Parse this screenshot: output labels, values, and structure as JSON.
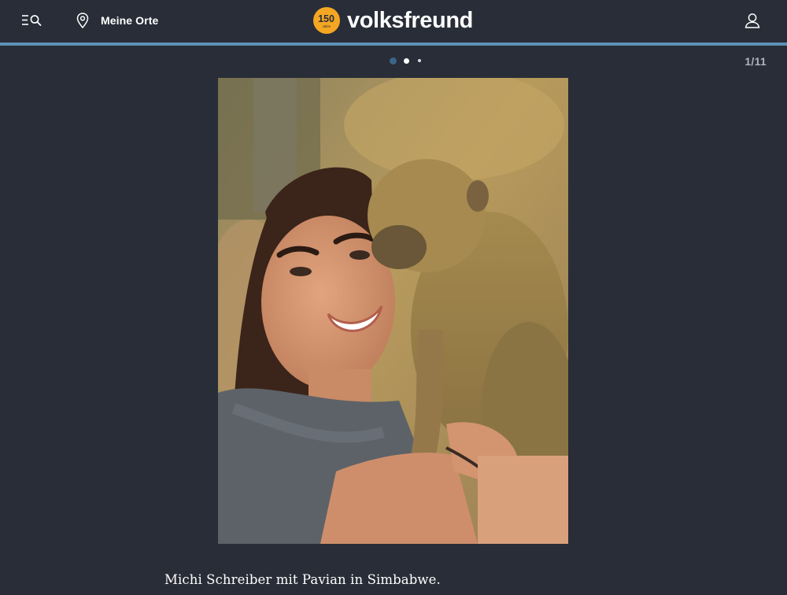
{
  "header": {
    "menu_search": {
      "icon": "menu-search-icon"
    },
    "places": {
      "icon": "location-pin-icon",
      "label": "Meine Orte"
    },
    "logo": {
      "badge_number": "150",
      "badge_sub": "Jahre",
      "brand": "volksfreund",
      "badge_color": "#f5a623"
    },
    "account": {
      "icon": "user-icon"
    },
    "accent_rule_color": "#5d91b3"
  },
  "gallery": {
    "counter": "1/11",
    "pagination_dots": [
      "active",
      "next",
      "more"
    ],
    "image": {
      "subject": "woman-with-baboon-photo"
    },
    "caption": "Michi Schreiber mit Pavian in Simbabwe."
  },
  "colors": {
    "background": "#292d37",
    "active_dot": "#3a6588"
  }
}
